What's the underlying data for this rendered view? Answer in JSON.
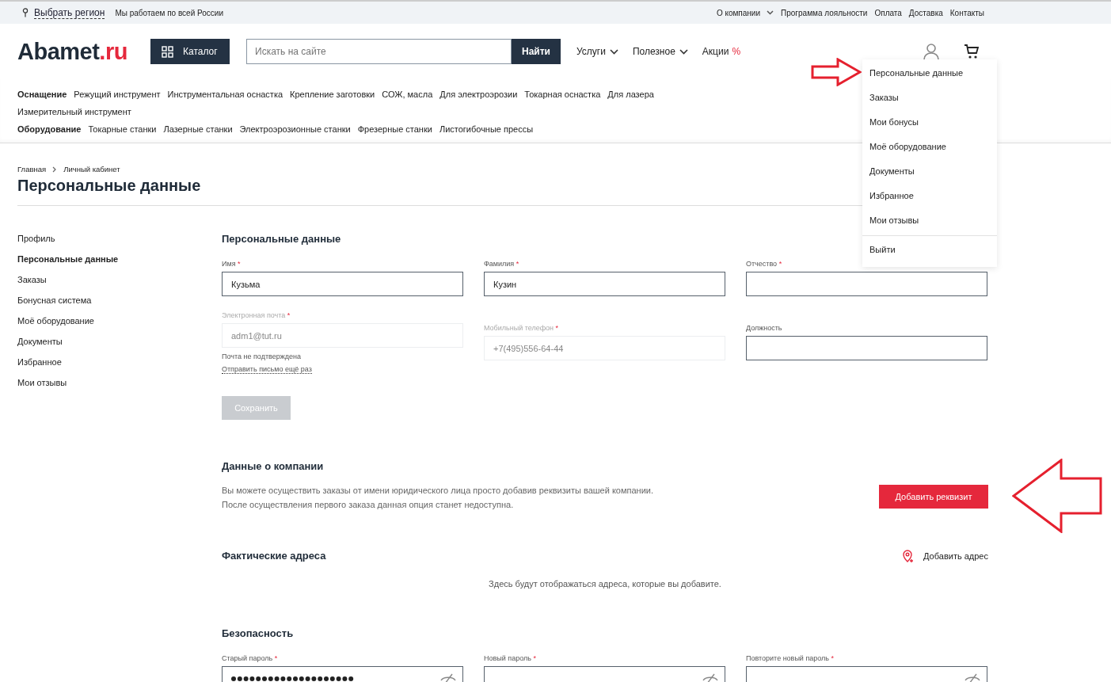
{
  "top_bar": {
    "region_link": "Выбрать регион",
    "tagline": "Мы работаем по всей России",
    "links": [
      {
        "label": "О компании",
        "dropdown": true
      },
      {
        "label": "Программа лояльности",
        "dropdown": false
      },
      {
        "label": "Оплата",
        "dropdown": false
      },
      {
        "label": "Доставка",
        "dropdown": false
      },
      {
        "label": "Контакты",
        "dropdown": false
      }
    ]
  },
  "header": {
    "logo_main": "Abamet",
    "logo_suffix": ".ru",
    "catalog_button": "Каталог",
    "search": {
      "placeholder": "Искать на сайте",
      "button": "Найти"
    },
    "nav": [
      {
        "label": "Услуги",
        "dropdown": true
      },
      {
        "label": "Полезное",
        "dropdown": true
      },
      {
        "label": "Акции",
        "badge": "%",
        "dropdown": false
      }
    ]
  },
  "category_nav": [
    {
      "heading": "Оснащение",
      "items": [
        "Режущий инструмент",
        "Инструментальная оснастка",
        "Крепление заготовки",
        "СОЖ, масла",
        "Для электроэрозии",
        "Токарная оснастка",
        "Для лазера",
        "Измерительный инструмент"
      ]
    },
    {
      "heading": "Оборудование",
      "items": [
        "Токарные станки",
        "Лазерные станки",
        "Электроэрозионные станки",
        "Фрезерные станки",
        "Листогибочные прессы"
      ]
    }
  ],
  "breadcrumbs": [
    "Главная",
    "Личный кабинет"
  ],
  "page_title": "Персональные данные",
  "sidebar": {
    "items": [
      {
        "label": "Профиль",
        "selected": false
      },
      {
        "label": "Персональные данные",
        "selected": true
      },
      {
        "label": "Заказы",
        "selected": false
      },
      {
        "label": "Бонусная система",
        "selected": false
      },
      {
        "label": "Моё оборудование",
        "selected": false
      },
      {
        "label": "Документы",
        "selected": false
      },
      {
        "label": "Избранное",
        "selected": false
      },
      {
        "label": "Мои отзывы",
        "selected": false
      }
    ]
  },
  "personal": {
    "title": "Персональные данные",
    "fields": [
      {
        "label": "Имя",
        "required_mark": "*",
        "value": "Кузьма",
        "disabled": false
      },
      {
        "label": "Фамилия",
        "required_mark": "*",
        "value": "Кузин",
        "disabled": false
      },
      {
        "label": "Отчество",
        "required_mark": "*",
        "disabled": false
      }
    ],
    "email": {
      "label": "Электронная почта",
      "required_mark": "*",
      "value": "adm1@tut.ru",
      "disabled": true,
      "note": "Почта не подтверждена",
      "resend_link": "Отправить письмо ещё раз"
    },
    "phone": {
      "label": "Мобильный телефон",
      "required_mark": "*",
      "value": "+7(495)556-64-44",
      "disabled": true
    },
    "position": {
      "label": "Должность",
      "disabled": false
    },
    "save_button": {
      "label": "Сохранить",
      "disabled": true
    }
  },
  "company": {
    "title": "Данные о компании",
    "text_lines": [
      "Вы можете осуществить заказы от имени юридического лица просто добавив реквизиты вашей компании.",
      "После осуществления первого заказа данная опция станет недоступна."
    ],
    "button": "Добавить реквизит"
  },
  "addresses": {
    "title": "Фактические адреса",
    "add_link": "Добавить адрес",
    "empty_text": "Здесь будут отображаться адреса, которые вы добавите."
  },
  "security": {
    "title": "Безопасность",
    "fields": [
      {
        "label": "Старый пароль",
        "required_mark": "*",
        "filled": true
      },
      {
        "label": "Новый пароль",
        "required_mark": "*",
        "filled": false
      },
      {
        "label": "Повторите новый пароль",
        "required_mark": "*",
        "filled": false
      }
    ]
  },
  "account_menu": {
    "items": [
      {
        "label": "Персональные данные",
        "separated": false
      },
      {
        "label": "Заказы",
        "separated": false
      },
      {
        "label": "Мои бонусы",
        "separated": false
      },
      {
        "label": "Моё оборудование",
        "separated": false
      },
      {
        "label": "Документы",
        "separated": false
      },
      {
        "label": "Избранное",
        "separated": false
      },
      {
        "label": "Мои отзывы",
        "separated": false
      },
      {
        "label": "Выйти",
        "separated": true
      }
    ]
  }
}
